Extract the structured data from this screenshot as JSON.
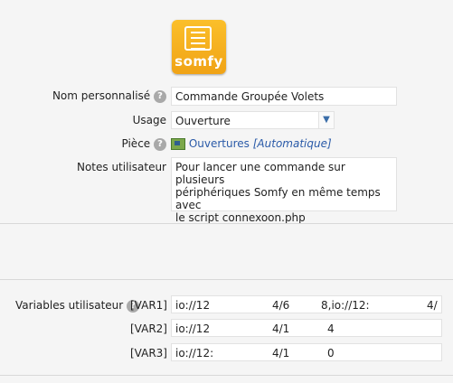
{
  "logo": {
    "brand_text": "somfy",
    "icon": "document-icon"
  },
  "form": {
    "nom_label": "Nom personnalisé",
    "nom_value": "Commande Groupée Volets",
    "usage_label": "Usage",
    "usage_value": "Ouverture",
    "piece_label": "Pièce",
    "piece_value": "Ouvertures",
    "piece_suffix": "[Automatique]",
    "notes_label": "Notes utilisateur",
    "notes_value": "Pour lancer une commande sur plusieurs\npériphériques Somfy en même temps avec\nle script connexoon.php"
  },
  "variables": {
    "label": "Variables utilisateur",
    "help": "?",
    "rows": [
      {
        "name": "[VAR1]",
        "parts": [
          "io://12",
          "4/6",
          "8,io://12:",
          "4/"
        ]
      },
      {
        "name": "[VAR2]",
        "parts": [
          "io://12",
          "4/1",
          "4"
        ]
      },
      {
        "name": "[VAR3]",
        "parts": [
          "io://12:",
          "4/1",
          "0"
        ]
      }
    ]
  },
  "colors": {
    "accent": "#f0a316",
    "link": "#2a5aa8"
  }
}
